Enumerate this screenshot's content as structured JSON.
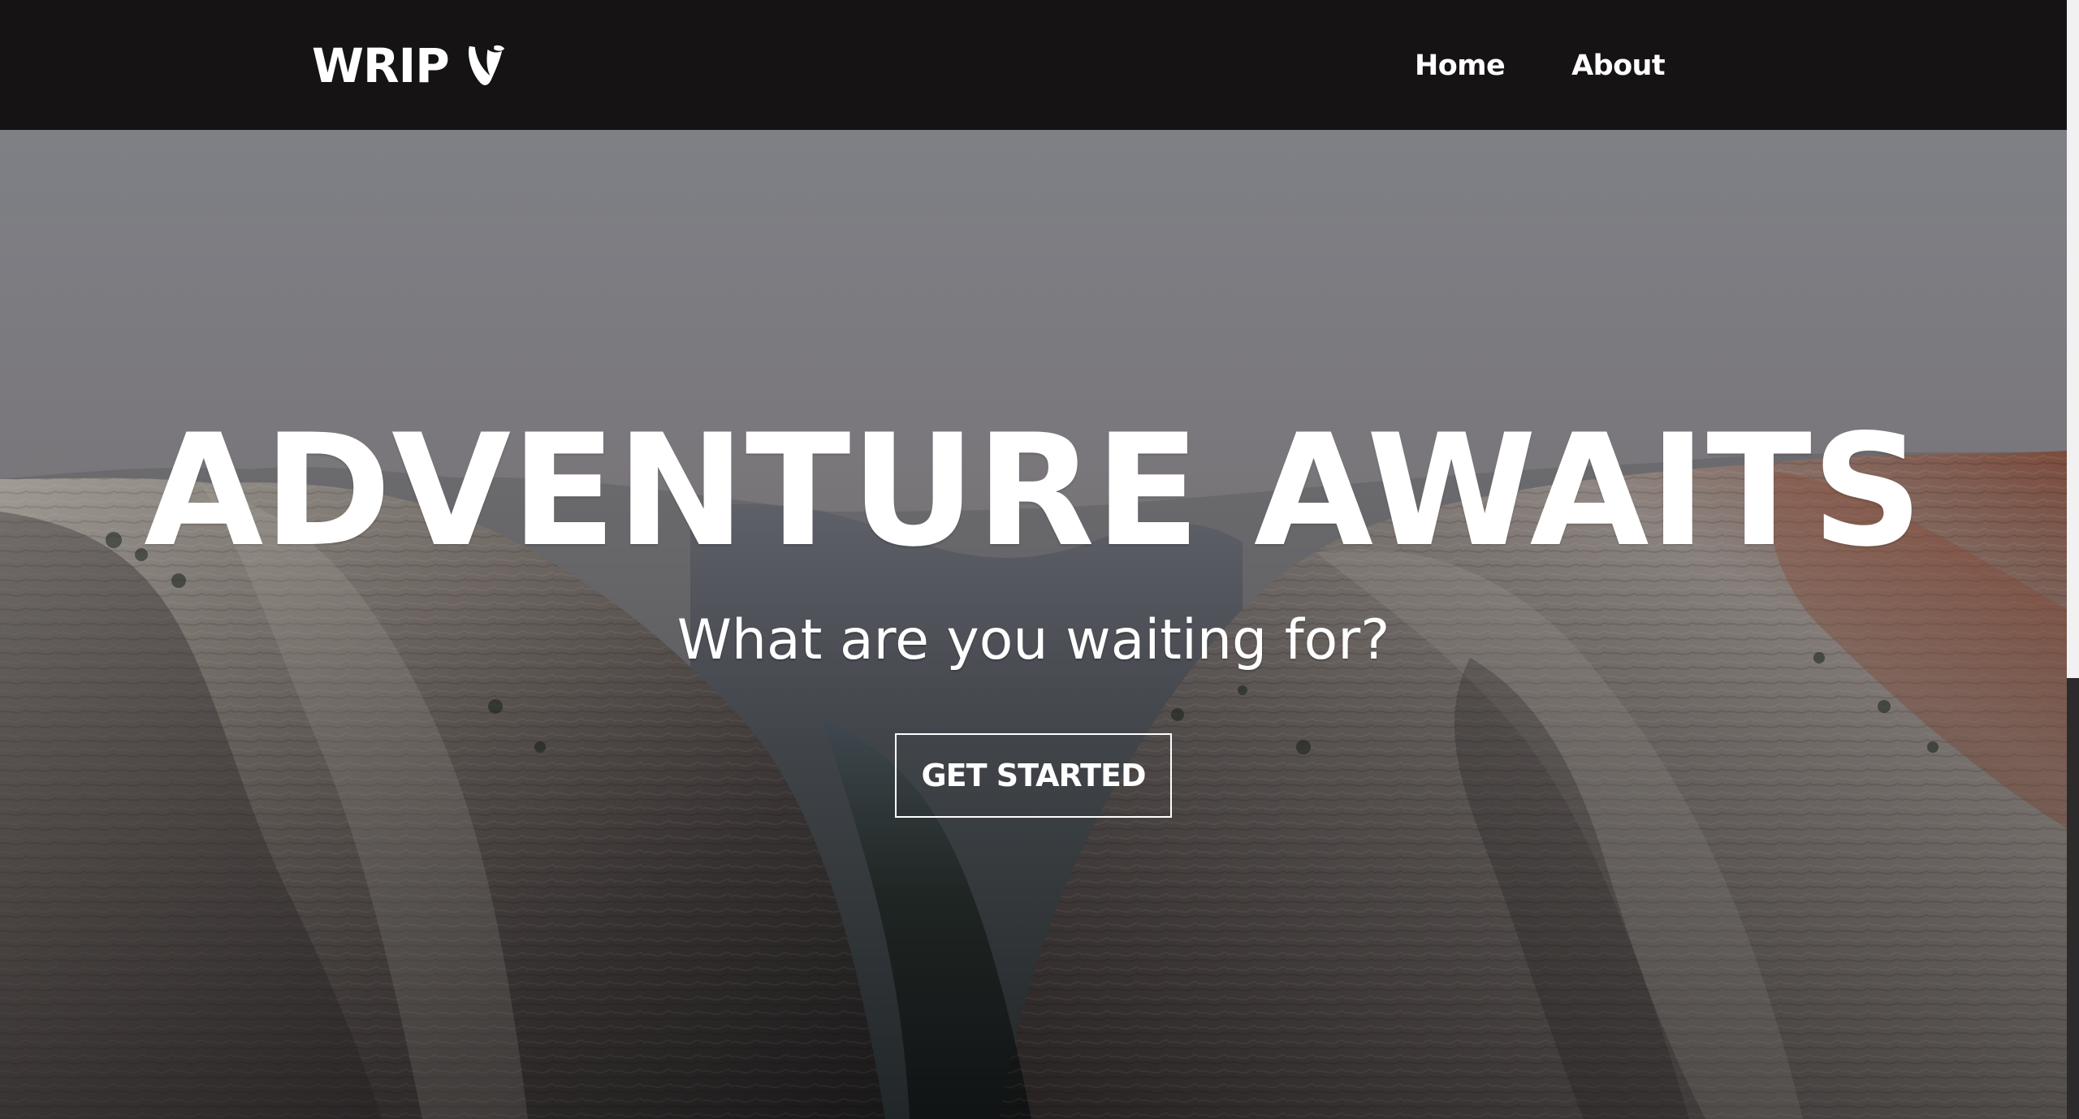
{
  "brand": {
    "name": "WRIP",
    "icon": "typo3-logo-icon"
  },
  "nav": {
    "items": [
      {
        "label": "Home"
      },
      {
        "label": "About"
      }
    ]
  },
  "hero": {
    "title": "ADVENTURE AWAITS",
    "subtitle": "What are you waiting for?",
    "button_label": "GET STARTED",
    "background": "canyon-landscape-image"
  },
  "colors": {
    "header_background": "#151314",
    "text": "#ffffff",
    "button_border": "#ffffff"
  }
}
